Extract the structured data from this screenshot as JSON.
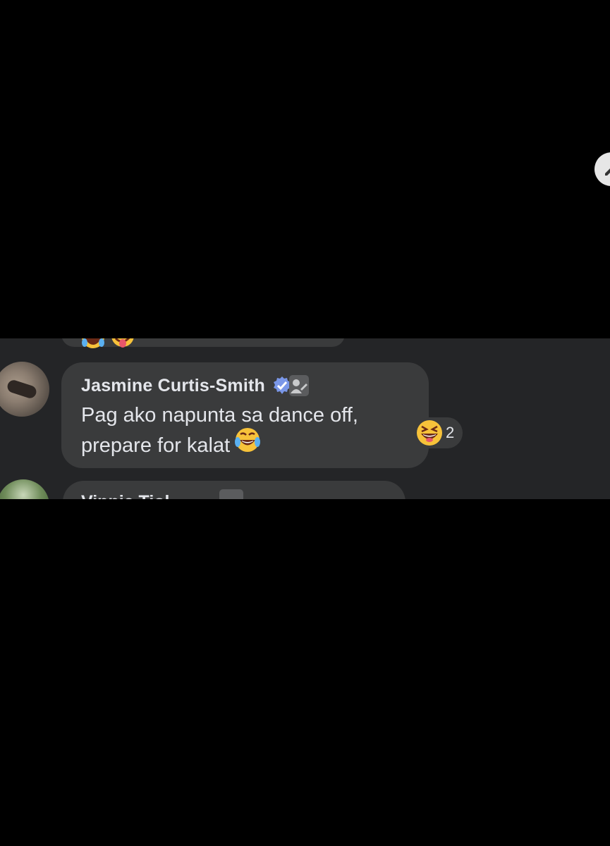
{
  "comment": {
    "author": "Jasmine Curtis-Smith",
    "text": "Pag ako napunta sa dance off,\nprepare for kalat",
    "text_emoji": "face-with-tears-of-joy",
    "reaction": {
      "emoji": "grinning-squinting-face",
      "count": "2"
    }
  },
  "previous_comment": {
    "emojis": [
      "face-with-tears-of-joy",
      "zany-face"
    ]
  },
  "next_comment": {
    "author_partial": "Vinnie Tiol"
  },
  "colors": {
    "page_background": "#000000",
    "screenshot_background": "#242527",
    "bubble": "#3a3b3c",
    "text": "#e4e6eb",
    "verified": "#7a97e8"
  }
}
